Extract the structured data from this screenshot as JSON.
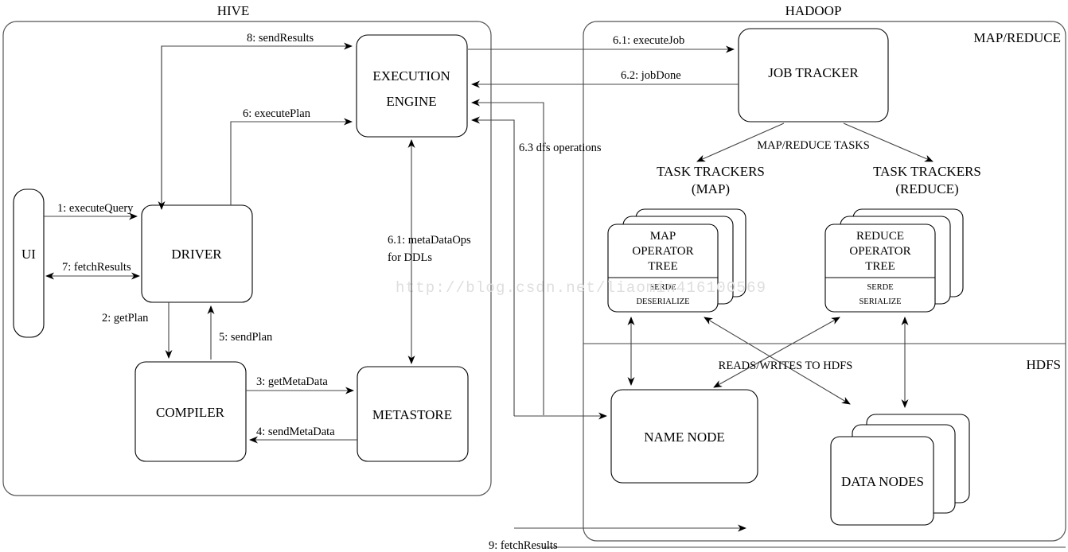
{
  "zones": {
    "hive": "HIVE",
    "hadoop": "HADOOP",
    "mapreduce": "MAP/REDUCE",
    "hdfs": "HDFS"
  },
  "boxes": {
    "ui": "UI",
    "driver": "DRIVER",
    "compiler": "COMPILER",
    "metastore": "METASTORE",
    "execution_engine_l1": "EXECUTION",
    "execution_engine_l2": "ENGINE",
    "job_tracker": "JOB TRACKER",
    "name_node": "NAME NODE",
    "data_nodes": "DATA NODES",
    "map_operator_l1": "MAP",
    "map_operator_l2": "OPERATOR",
    "map_operator_l3": "TREE",
    "map_serde_l1": "SERDE",
    "map_serde_l2": "DESERIALIZE",
    "reduce_operator_l1": "REDUCE",
    "reduce_operator_l2": "OPERATOR",
    "reduce_operator_l3": "TREE",
    "reduce_serde_l1": "SERDE",
    "reduce_serde_l2": "SERIALIZE"
  },
  "group_labels": {
    "task_trackers_map_l1": "TASK TRACKERS",
    "task_trackers_map_l2": "(MAP)",
    "task_trackers_reduce_l1": "TASK TRACKERS",
    "task_trackers_reduce_l2": "(REDUCE)"
  },
  "edges": {
    "e1": "1: executeQuery",
    "e2": "2: getPlan",
    "e3": "3: getMetaData",
    "e4": "4: sendMetaData",
    "e5": "5: sendPlan",
    "e6": "6: executePlan",
    "e61_job": "6.1: executeJob",
    "e62": "6.2: jobDone",
    "e63": "6.3 dfs operations",
    "e61_meta_l1": "6.1: metaDataOps",
    "e61_meta_l2": "for DDLs",
    "e7": "7: fetchResults",
    "e8": "8: sendResults",
    "e9": "9: fetchResults",
    "mr_tasks": "MAP/REDUCE TASKS",
    "reads_writes": "READS/WRITES TO HDFS"
  },
  "watermark": "http://blog.csdn.net/liaomin416100569",
  "colors": {
    "stroke": "#000000",
    "container_stroke": "#555555",
    "line": "#444444",
    "background": "#ffffff",
    "watermark": "#dedede"
  }
}
